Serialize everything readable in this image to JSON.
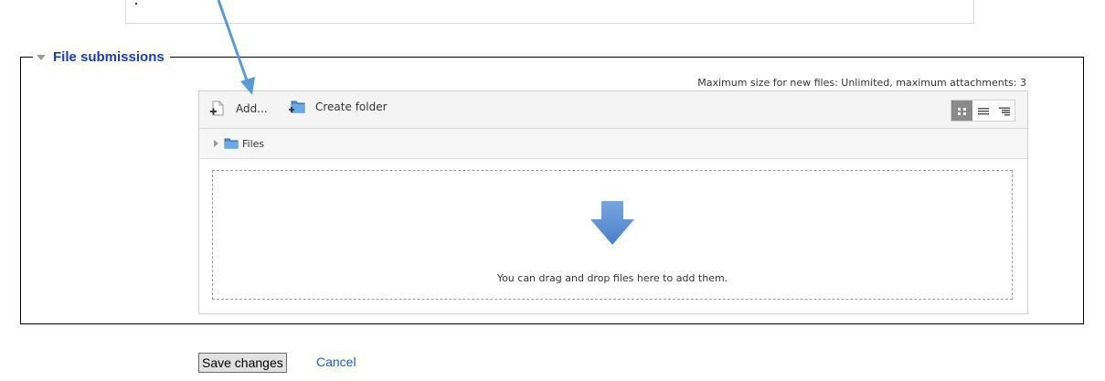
{
  "fieldset": {
    "legend": "File submissions"
  },
  "filemanager": {
    "max_size_text": "Maximum size for new files: Unlimited, maximum attachments: 3",
    "toolbar": {
      "add_label": "Add...",
      "create_folder_label": "Create folder"
    },
    "path": {
      "folder_label": "Files"
    },
    "dropzone": {
      "message": "You can drag and drop files here to add them."
    },
    "views": [
      "icons-view",
      "list-view",
      "tree-view"
    ],
    "active_view": "icons-view"
  },
  "actions": {
    "save_label": "Save changes",
    "cancel_label": "Cancel"
  },
  "colors": {
    "legend": "#1f3bb3",
    "link": "#1a5fb4",
    "folder": "#4a8fd8",
    "drop_arrow": "#5b8fd6",
    "annotation_arrow": "#5b9bd5"
  }
}
